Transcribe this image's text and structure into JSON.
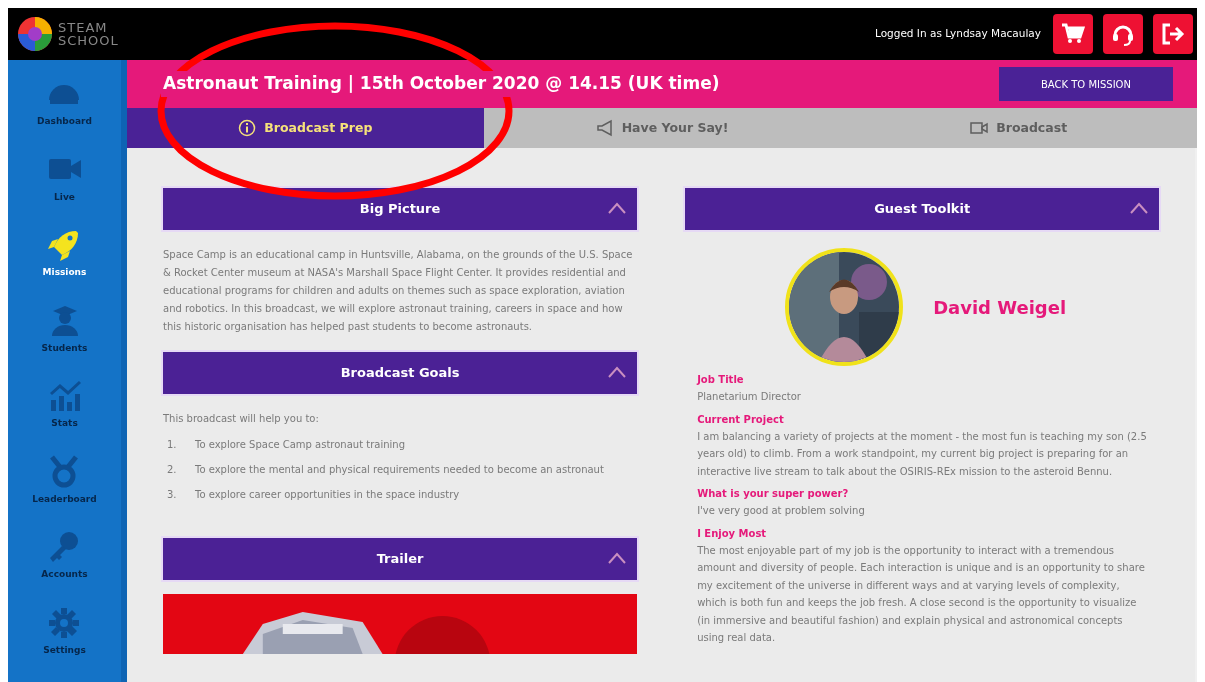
{
  "brand": {
    "line1": "STEAM",
    "line2": "SCHOOL"
  },
  "user": {
    "logged_in_text": "Logged In as Lyndsay Macaulay"
  },
  "header_actions": [
    {
      "kind": "cart"
    },
    {
      "kind": "support"
    },
    {
      "kind": "logout"
    }
  ],
  "sidebar": {
    "items": [
      {
        "label": "Dashboard",
        "kind": "dashboard",
        "selected": false
      },
      {
        "label": "Live",
        "kind": "live",
        "selected": false
      },
      {
        "label": "Missions",
        "kind": "missions",
        "selected": true
      },
      {
        "label": "Students",
        "kind": "students",
        "selected": false
      },
      {
        "label": "Stats",
        "kind": "stats",
        "selected": false
      },
      {
        "label": "Leaderboard",
        "kind": "leaderboard",
        "selected": false
      },
      {
        "label": "Accounts",
        "kind": "accounts",
        "selected": false
      },
      {
        "label": "Settings",
        "kind": "settings",
        "selected": false
      }
    ]
  },
  "page_title": "Astronaut Training | 15th October 2020 @ 14.15 (UK time)",
  "back_button": "BACK TO MISSION",
  "tabs": [
    {
      "label": "Broadcast Prep",
      "kind": "info",
      "selected": true
    },
    {
      "label": "Have Your Say!",
      "kind": "megaphone",
      "selected": false
    },
    {
      "label": "Broadcast",
      "kind": "video",
      "selected": false
    }
  ],
  "big_picture": {
    "title": "Big Picture",
    "expanded": true,
    "text": "Space Camp is an educational camp in Huntsville, Alabama, on the grounds of the U.S. Space & Rocket Center museum at NASA's Marshall Space Flight Center. It provides residential and educational programs for children and adults on themes such as space exploration, aviation and robotics. In this broadcast, we will explore astronaut training, careers in space and how this historic organisation has helped past students to become astronauts."
  },
  "broadcast_goals": {
    "title": "Broadcast Goals",
    "expanded": true,
    "intro": "This broadcast will help you to:",
    "goals": [
      {
        "number": "1.",
        "text": "To explore Space Camp astronaut training"
      },
      {
        "number": "2.",
        "text": "To explore the mental and physical requirements needed to become an astronaut"
      },
      {
        "number": "3.",
        "text": "To explore career opportunities in the space industry"
      }
    ]
  },
  "trailer": {
    "title": "Trailer",
    "expanded": true
  },
  "guest_toolkit": {
    "title": "Guest Toolkit",
    "expanded": true,
    "name": "David Weigel",
    "fields": [
      {
        "label": "Job Title",
        "value": "Planetarium Director"
      },
      {
        "label": "Current Project",
        "value": "I am balancing a variety of projects at the moment - the most fun is teaching my son (2.5 years old) to climb. From a work standpoint, my current big project is preparing for an interactive live stream to talk about the OSIRIS-REx mission to the asteroid Bennu."
      },
      {
        "label": "What is your super power?",
        "value": "I've very good at problem solving"
      },
      {
        "label": "I Enjoy Most",
        "value": "The most enjoyable part of my job is the opportunity to interact with a tremendous amount and diversity of people. Each interaction is unique and is an opportunity to share my excitement of the universe in different ways and at varying levels of complexity, which is both fun and keeps the job fresh. A close second is the opportunity to visualize (in immersive and beautiful fashion) and explain physical and astronomical concepts using real data."
      }
    ]
  },
  "annotations": [
    {
      "kind": "ellipse",
      "color": "#ff0000"
    }
  ]
}
